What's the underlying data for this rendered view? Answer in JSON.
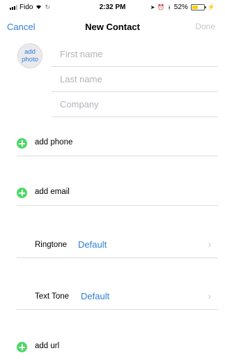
{
  "status_bar": {
    "carrier": "Fido",
    "time": "2:32 PM",
    "battery_percent": "52%",
    "battery_level": 0.52,
    "icons": [
      "signal-icon",
      "wifi-icon",
      "sync-icon",
      "location-icon",
      "alarm-icon",
      "bluetooth-icon",
      "battery-icon",
      "charging-icon"
    ]
  },
  "nav": {
    "cancel_label": "Cancel",
    "title": "New Contact",
    "done_label": "Done"
  },
  "photo": {
    "label": "add photo"
  },
  "name_fields": {
    "first_placeholder": "First name",
    "first_value": "",
    "last_placeholder": "Last name",
    "last_value": "",
    "company_placeholder": "Company",
    "company_value": ""
  },
  "rows": {
    "add_phone": "add phone",
    "add_email": "add email",
    "ringtone_label": "Ringtone",
    "ringtone_value": "Default",
    "text_tone_label": "Text Tone",
    "text_tone_value": "Default",
    "add_url": "add url"
  },
  "colors": {
    "accent": "#2f7fd6",
    "add_green": "#4cd964",
    "disabled": "#c7c7cc",
    "battery": "#f5d000"
  }
}
